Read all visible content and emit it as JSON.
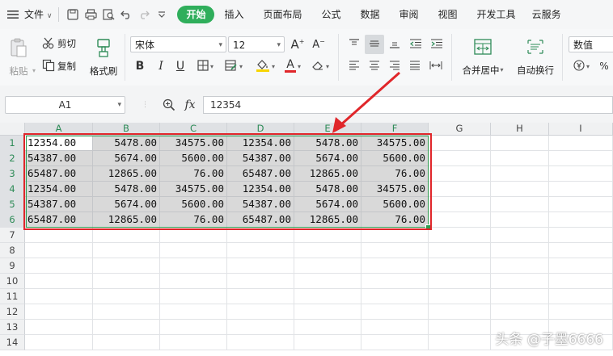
{
  "menu": {
    "file_label": "文件",
    "tabs": [
      "插入",
      "页面布局",
      "公式",
      "数据",
      "审阅",
      "视图",
      "开发工具",
      "云服务"
    ],
    "active_tab": "开始"
  },
  "ribbon": {
    "paste": "粘贴",
    "cut": "剪切",
    "copy": "复制",
    "format_painter": "格式刷",
    "font_name": "宋体",
    "font_size": "12",
    "merge_center": "合并居中",
    "wrap_text": "自动换行",
    "number_format": "数值",
    "percent": "%",
    "bold": "B",
    "italic": "I",
    "underline": "U",
    "font_color_glyph": "A",
    "grow_font_glyph": "A",
    "shrink_font_glyph": "A"
  },
  "formula_bar": {
    "name_box": "A1",
    "fx_label": "fx",
    "value": "12354"
  },
  "sheet": {
    "columns": [
      "A",
      "B",
      "C",
      "D",
      "E",
      "F",
      "G",
      "H",
      "I"
    ],
    "rows": [
      "1",
      "2",
      "3",
      "4",
      "5",
      "6",
      "7",
      "8",
      "9",
      "10",
      "11",
      "12",
      "13",
      "14"
    ],
    "data": [
      [
        "12354.00",
        "5478.00",
        "34575.00",
        "12354.00",
        "5478.00",
        "34575.00"
      ],
      [
        "54387.00",
        "5674.00",
        "5600.00",
        "54387.00",
        "5674.00",
        "5600.00"
      ],
      [
        "65487.00",
        "12865.00",
        "76.00",
        "65487.00",
        "12865.00",
        "76.00"
      ],
      [
        "12354.00",
        "5478.00",
        "34575.00",
        "12354.00",
        "5478.00",
        "34575.00"
      ],
      [
        "54387.00",
        "5674.00",
        "5600.00",
        "54387.00",
        "5674.00",
        "5600.00"
      ],
      [
        "65487.00",
        "12865.00",
        "76.00",
        "65487.00",
        "12865.00",
        "76.00"
      ]
    ]
  },
  "colors": {
    "accent_green": "#2fae5b",
    "annotation_red": "#e0262a",
    "selection_border": "#2e9a4e"
  },
  "watermark": "头条 @子墨6666"
}
